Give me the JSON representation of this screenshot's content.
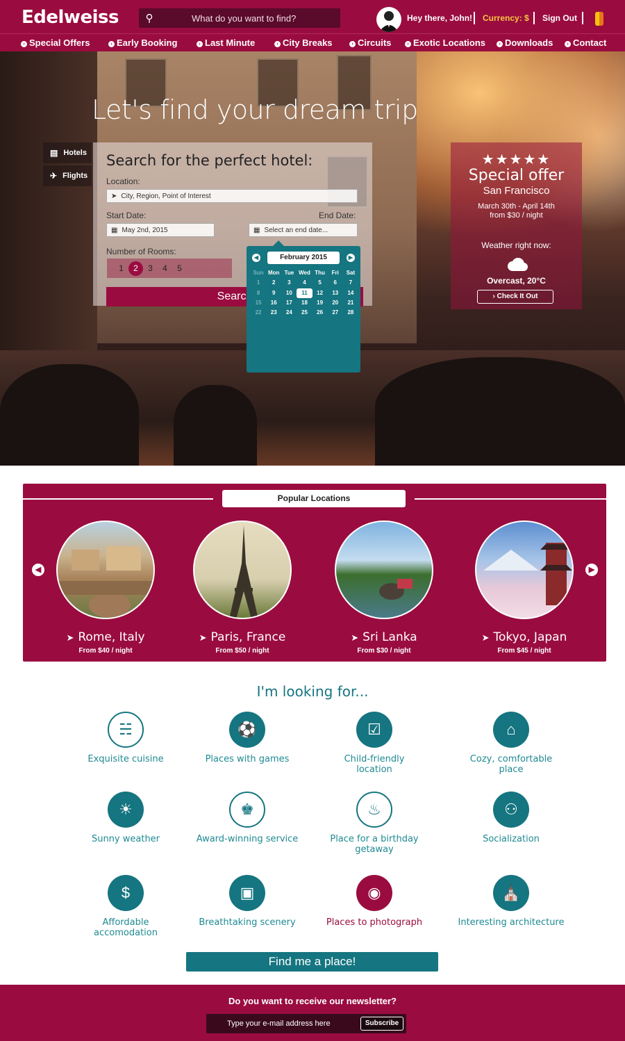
{
  "header": {
    "logo": "Edelweiss",
    "search_placeholder": "What do you want to find?",
    "greeting": "Hey there, John!",
    "currency": "Currency: $",
    "sign_out": "Sign Out"
  },
  "nav": [
    "Special Offers",
    "Early Booking",
    "Last Minute",
    "City Breaks",
    "Circuits",
    "Exotic Locations",
    "Downloads",
    "Contact"
  ],
  "hero": {
    "title": "Let's find your dream trip",
    "tabs": [
      "Hotels",
      "Flights"
    ]
  },
  "hotel_search": {
    "title": "Search for the perfect hotel:",
    "location_label": "Location:",
    "location_placeholder": "City, Region, Point of Interest",
    "start_label": "Start Date:",
    "start_value": "May 2nd, 2015",
    "end_label": "End Date:",
    "end_placeholder": "Select an end date...",
    "rooms_label": "Number of Rooms:",
    "rooms": [
      "1",
      "2",
      "3",
      "4",
      "5"
    ],
    "rooms_selected": "2",
    "search_button": "Search"
  },
  "calendar": {
    "month": "February 2015",
    "weekdays": [
      "Sun",
      "Mon",
      "Tue",
      "Wed",
      "Thu",
      "Fri",
      "Sat"
    ],
    "weeks": [
      [
        "1",
        "2",
        "3",
        "4",
        "5",
        "6",
        "7"
      ],
      [
        "8",
        "9",
        "10",
        "11",
        "12",
        "13",
        "14"
      ],
      [
        "15",
        "16",
        "17",
        "18",
        "19",
        "20",
        "21"
      ],
      [
        "22",
        "23",
        "24",
        "25",
        "26",
        "27",
        "28"
      ]
    ],
    "today": "11"
  },
  "offer": {
    "stars": "★★★★★",
    "rating": 5,
    "title": "Special offer",
    "city": "San Francisco",
    "dates": "March 30th - April 14th",
    "price": "from $30 / night",
    "weather_label": "Weather right now:",
    "weather": "Overcast, 20°C",
    "check_button": "Check It Out"
  },
  "popular": {
    "title": "Popular Locations",
    "locations": [
      {
        "name": "Rome, Italy",
        "price": "From $40 / night"
      },
      {
        "name": "Paris, France",
        "price": "From $50 / night"
      },
      {
        "name": "Sri Lanka",
        "price": "From $30 / night"
      },
      {
        "name": "Tokyo, Japan",
        "price": "From $45 / night"
      }
    ]
  },
  "looking": {
    "title": "I'm looking for...",
    "items": [
      {
        "label": "Exquisite cuisine",
        "icon": "cutlery-icon"
      },
      {
        "label": "Places with games",
        "icon": "soccer-ball-icon"
      },
      {
        "label": "Child-friendly location",
        "icon": "child-icon"
      },
      {
        "label": "Cozy, comfortable place",
        "icon": "home-icon"
      },
      {
        "label": "Sunny weather",
        "icon": "sun-icon"
      },
      {
        "label": "Award-winning service",
        "icon": "trophy-icon"
      },
      {
        "label": "Place for a birthday getaway",
        "icon": "cake-icon"
      },
      {
        "label": "Socialization",
        "icon": "people-icon"
      },
      {
        "label": "Affordable accomodation",
        "icon": "dollar-icon"
      },
      {
        "label": "Breathtaking scenery",
        "icon": "picture-icon"
      },
      {
        "label": "Places to photograph",
        "icon": "camera-icon"
      },
      {
        "label": "Interesting architecture",
        "icon": "building-icon"
      }
    ],
    "find_button": "Find me a place!"
  },
  "newsletter": {
    "question": "Do you want to receive our newsletter?",
    "placeholder": "Type your e-mail address here",
    "button": "Subscribe"
  },
  "colors": {
    "brand": "#9a0c3f",
    "accent": "#157580"
  }
}
